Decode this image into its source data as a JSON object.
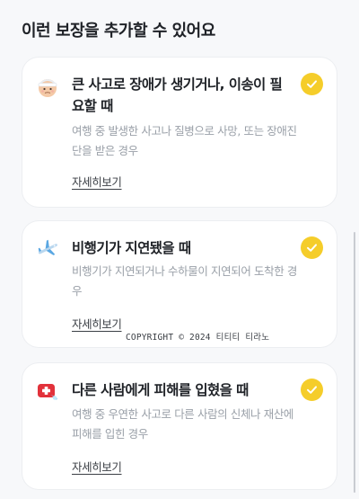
{
  "section": {
    "title": "이런 보장을 추가할 수 있어요"
  },
  "cards": [
    {
      "icon": "injured-person-icon",
      "title": "큰 사고로 장애가 생기거나, 이송이 필요할 때",
      "description": "여행 중 발생한 사고나 질병으로 사망, 또는 장애진단을 받은 경우",
      "link": "자세히보기",
      "checked": true
    },
    {
      "icon": "airplane-icon",
      "title": "비행기가 지연됐을 때",
      "description": "비행기가 지연되거나 수하물이 지연되어 도착한 경우",
      "link": "자세히보기",
      "checked": true
    },
    {
      "icon": "first-aid-kit-icon",
      "title": "다른 사람에게 피해를 입혔을 때",
      "description": "여행 중 우연한 사고로 다른 사람의 신체나 재산에 피해를 입힌 경우",
      "link": "자세히보기",
      "checked": true
    }
  ],
  "watermark": {
    "text": "COPYRIGHT © 2024 티티티 티라노"
  },
  "colors": {
    "accent": "#f5cd2a",
    "background": "#f7f8fa",
    "card": "#ffffff",
    "muted_text": "#9aa0a8"
  }
}
